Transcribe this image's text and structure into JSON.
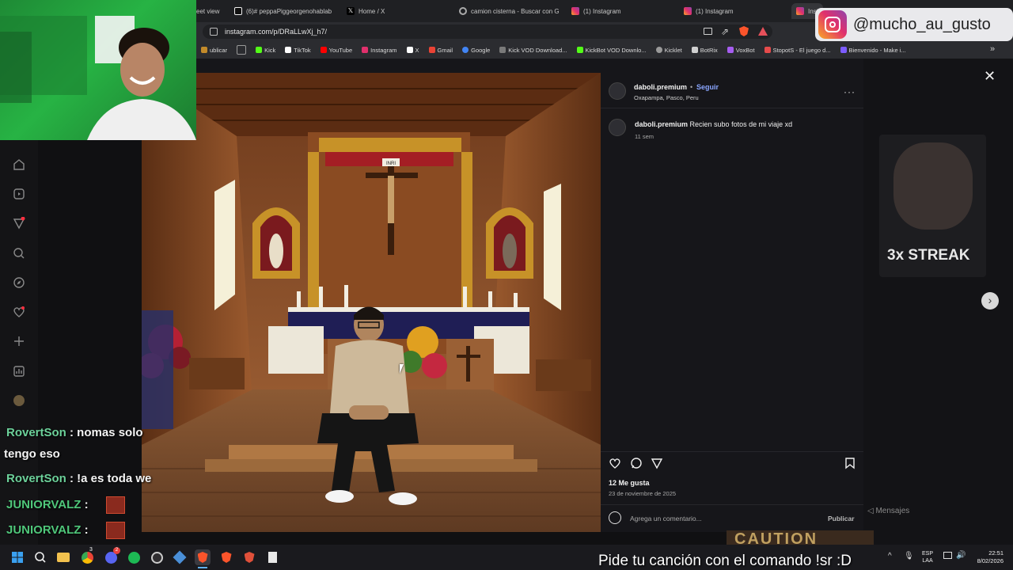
{
  "browser": {
    "tabs": [
      {
        "label": "eet view",
        "icon": "tab-icon",
        "active": false
      },
      {
        "label": "(6)# peppaPiggeorgenohablab",
        "icon": "tiktok-icon",
        "active": false
      },
      {
        "label": "Home / X",
        "icon": "x-icon",
        "active": false
      },
      {
        "label": "camion cisterna - Buscar con G",
        "icon": "google-icon",
        "active": false
      },
      {
        "label": "(1) Instagram",
        "icon": "instagram-icon",
        "active": false
      },
      {
        "label": "(1) Instagram",
        "icon": "instagram-icon",
        "active": false
      },
      {
        "label": "Inst",
        "icon": "instagram-icon",
        "active": true
      }
    ],
    "url": "instagram.com/p/DRaLLwXj_h7/",
    "bookmarks": [
      {
        "label": "ublicar",
        "color": "#c28a2a"
      },
      {
        "label": "",
        "color": "#8e8e8e"
      },
      {
        "label": "Kick",
        "color": "#53fc18"
      },
      {
        "label": "TikTok",
        "color": "#ffffff"
      },
      {
        "label": "YouTube",
        "color": "#ff0000"
      },
      {
        "label": "Instagram",
        "color": "#e1306c"
      },
      {
        "label": "X",
        "color": "#ffffff"
      },
      {
        "label": "Gmail",
        "color": "#ea4335"
      },
      {
        "label": "Google",
        "color": "#4285f4"
      },
      {
        "label": "Kick VOD Download...",
        "color": "#7a7a7a"
      },
      {
        "label": "KickBot VOD Downlo...",
        "color": "#53fc18"
      },
      {
        "label": "Kicklet",
        "color": "#9a9a9a"
      },
      {
        "label": "BotRix",
        "color": "#d0d0d0"
      },
      {
        "label": "VoxBot",
        "color": "#a65df0"
      },
      {
        "label": "StopotS - El juego d...",
        "color": "#e64b4b"
      },
      {
        "label": "Bienvenido - Make i...",
        "color": "#7c5cff"
      }
    ]
  },
  "overlay": {
    "instagram_handle": "@mucho_au_gusto",
    "streak": "3x STREAK",
    "song_command": "Pide tu canción con el comando !sr :D",
    "messages_label": "Mensajes",
    "banner_text": "CAUTION"
  },
  "chat": [
    {
      "user": "RovertSon",
      "text": ": nomas solo",
      "cont": "tengo eso"
    },
    {
      "user": "RovertSon",
      "text": ": !a es toda we",
      "cont": ""
    },
    {
      "user": "JUNIORVALZ",
      "text": ":",
      "cont": ""
    },
    {
      "user": "JUNIORVALZ",
      "text": ":",
      "cont": ""
    }
  ],
  "post": {
    "username": "daboli.premium",
    "follow": "Seguir",
    "location": "Oxapampa, Pasco, Peru",
    "caption_user": "daboli.premium",
    "caption": "Recien subo fotos de mi viaje xd",
    "caption_time": "11 sem",
    "likes": "12 Me gusta",
    "date": "23 de noviembre de 2025",
    "comment_placeholder": "Agrega un comentario...",
    "publish": "Publicar",
    "photo_sign": "INRI"
  },
  "taskbar": {
    "lang": "ESP",
    "lang2": "LAA",
    "time": "22:51",
    "date": "8/02/2026",
    "badges": {
      "discord": "2",
      "app": "3"
    }
  },
  "colors": {
    "accent": "#8aa6ff",
    "chat_user": "#6cd19a"
  }
}
